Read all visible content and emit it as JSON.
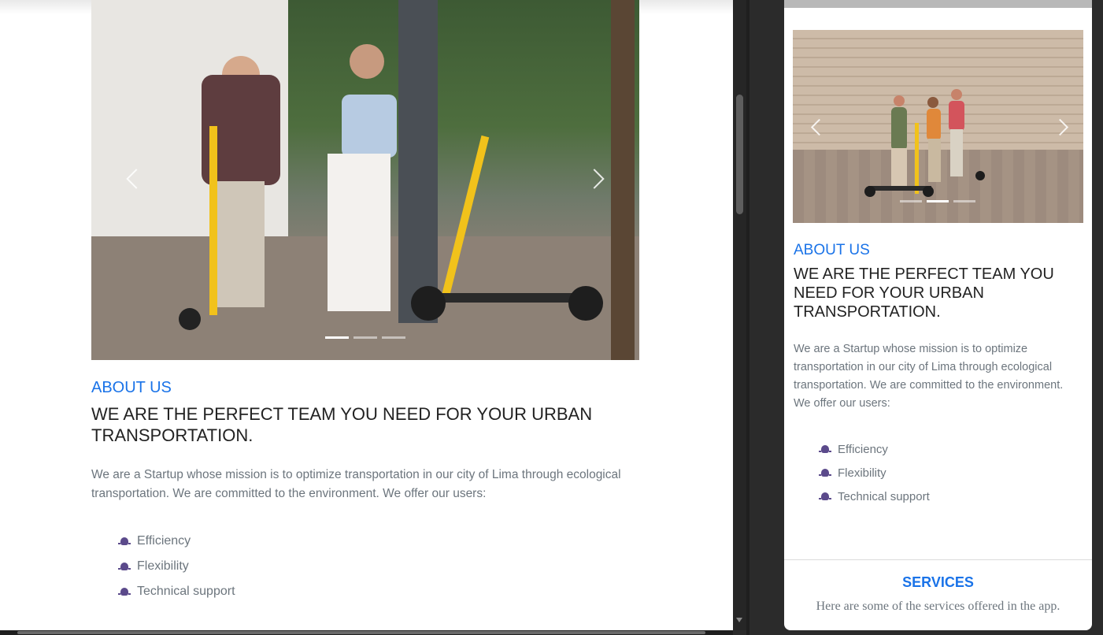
{
  "desktop": {
    "about": {
      "eyebrow": "ABOUT US",
      "headline": "WE ARE THE PERFECT TEAM YOU NEED FOR YOUR URBAN TRANSPORTATION.",
      "description": "We are a Startup whose mission is to optimize transportation in our city of Lima through ecological transportation. We are committed to the environment. We offer our users:",
      "features": [
        "Efficiency",
        "Flexibility",
        "Technical support"
      ]
    },
    "carousel": {
      "slide_count": 3,
      "active_slide": 1
    }
  },
  "mobile": {
    "about": {
      "eyebrow": "ABOUT US",
      "headline": "WE ARE THE PERFECT TEAM YOU NEED FOR YOUR URBAN TRANSPORTATION.",
      "description": "We are a Startup whose mission is to optimize transportation in our city of Lima through ecological transportation. We are committed to the environment. We offer our users:",
      "features": [
        "Efficiency",
        "Flexibility",
        "Technical support"
      ]
    },
    "carousel": {
      "slide_count": 3,
      "active_slide": 2
    },
    "services": {
      "title": "SERVICES",
      "subtitle": "Here are some of the services offered in the app."
    }
  },
  "colors": {
    "accent": "#1a73e8",
    "icon": "#5b4a8b",
    "text_muted": "#6c757d"
  },
  "icons": {
    "feature_bullet": "space-invader-icon",
    "prev": "chevron-left-icon",
    "next": "chevron-right-icon"
  }
}
